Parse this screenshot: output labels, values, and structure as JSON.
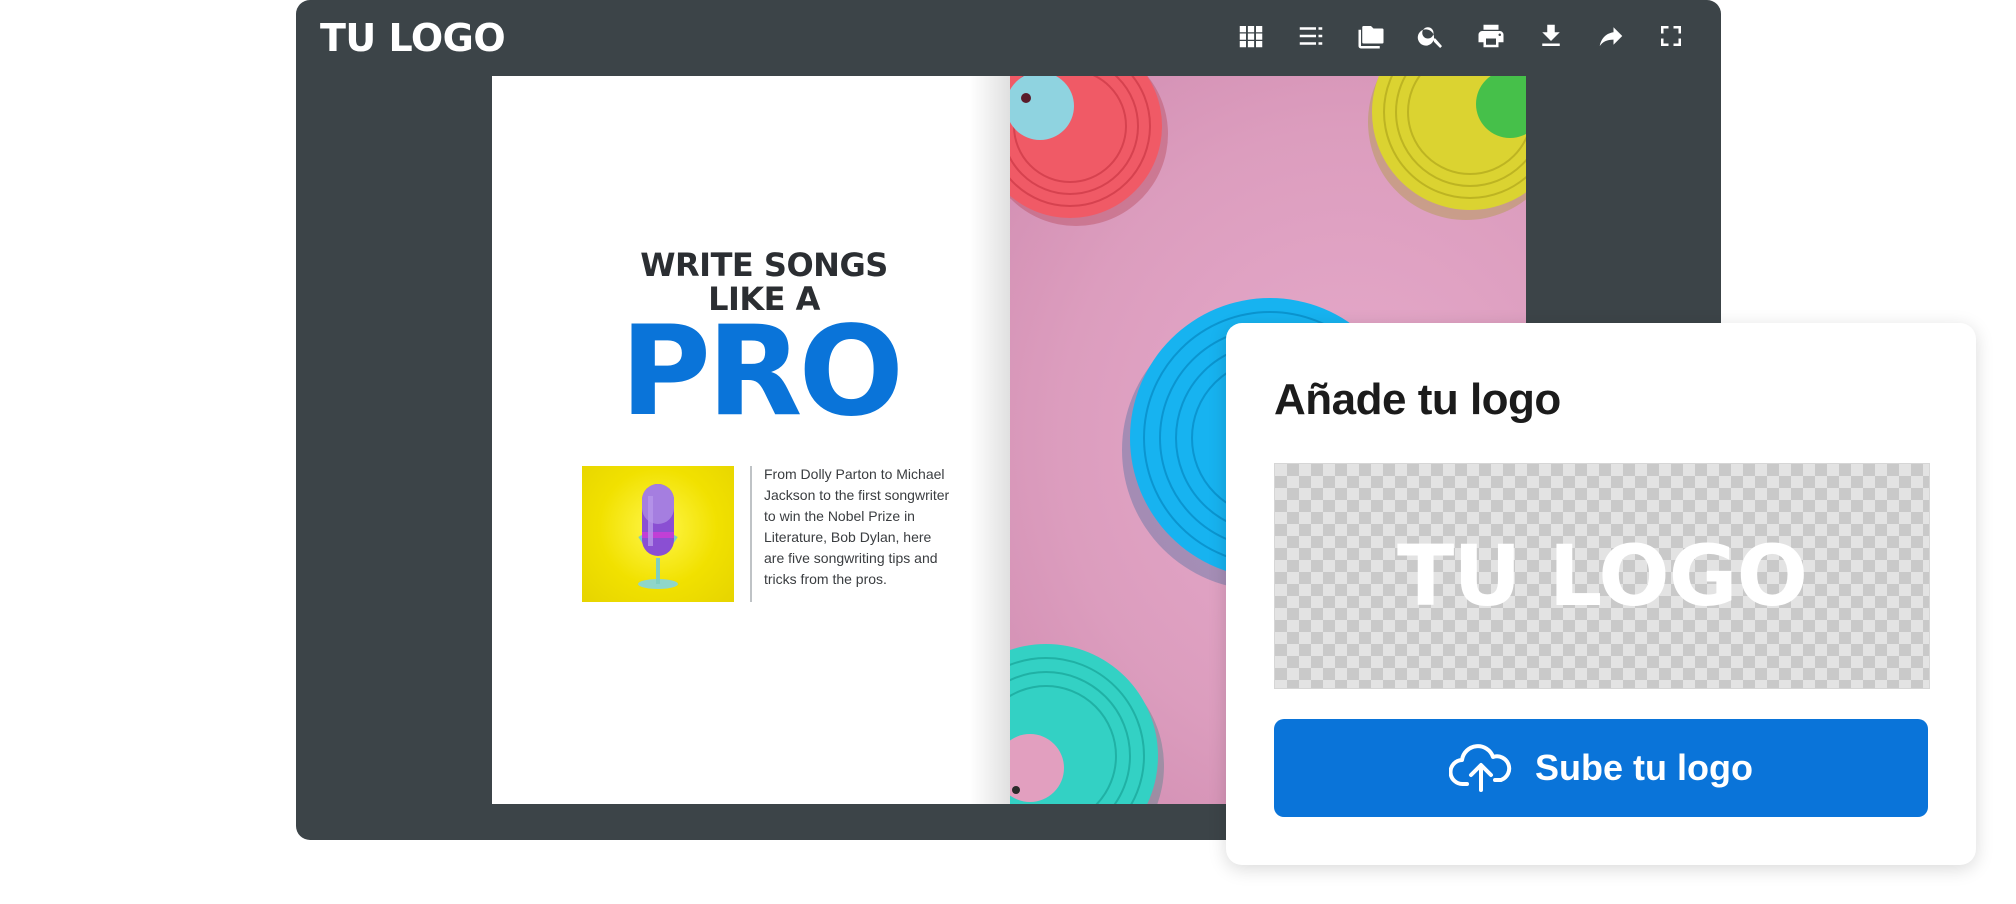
{
  "viewer": {
    "brand": "TU LOGO",
    "toolbar": [
      {
        "name": "grid-view",
        "icon": "grid-icon"
      },
      {
        "name": "table-of-contents",
        "icon": "list-icon"
      },
      {
        "name": "folders",
        "icon": "folder-icon"
      },
      {
        "name": "search",
        "icon": "search-icon"
      },
      {
        "name": "print",
        "icon": "print-icon"
      },
      {
        "name": "download",
        "icon": "download-icon"
      },
      {
        "name": "share",
        "icon": "share-icon"
      },
      {
        "name": "fullscreen",
        "icon": "fullscreen-icon"
      }
    ]
  },
  "book": {
    "headline": "WRITE SONGS\nLIKE A",
    "headline_big": "PRO",
    "blurb": "From Dolly Parton to Michael Jackson to the first songwriter to win the Nobel Prize in Literature, Bob Dylan, here are five songwriting tips and tricks from the pros."
  },
  "upload_card": {
    "title": "Añade tu logo",
    "preview_text": "TU LOGO",
    "button_label": "Sube tu logo"
  },
  "colors": {
    "viewer_bg": "#3c4448",
    "accent": "#0a74d9",
    "headline": "#2b2e32",
    "page_pink": "#dc9dbe"
  }
}
